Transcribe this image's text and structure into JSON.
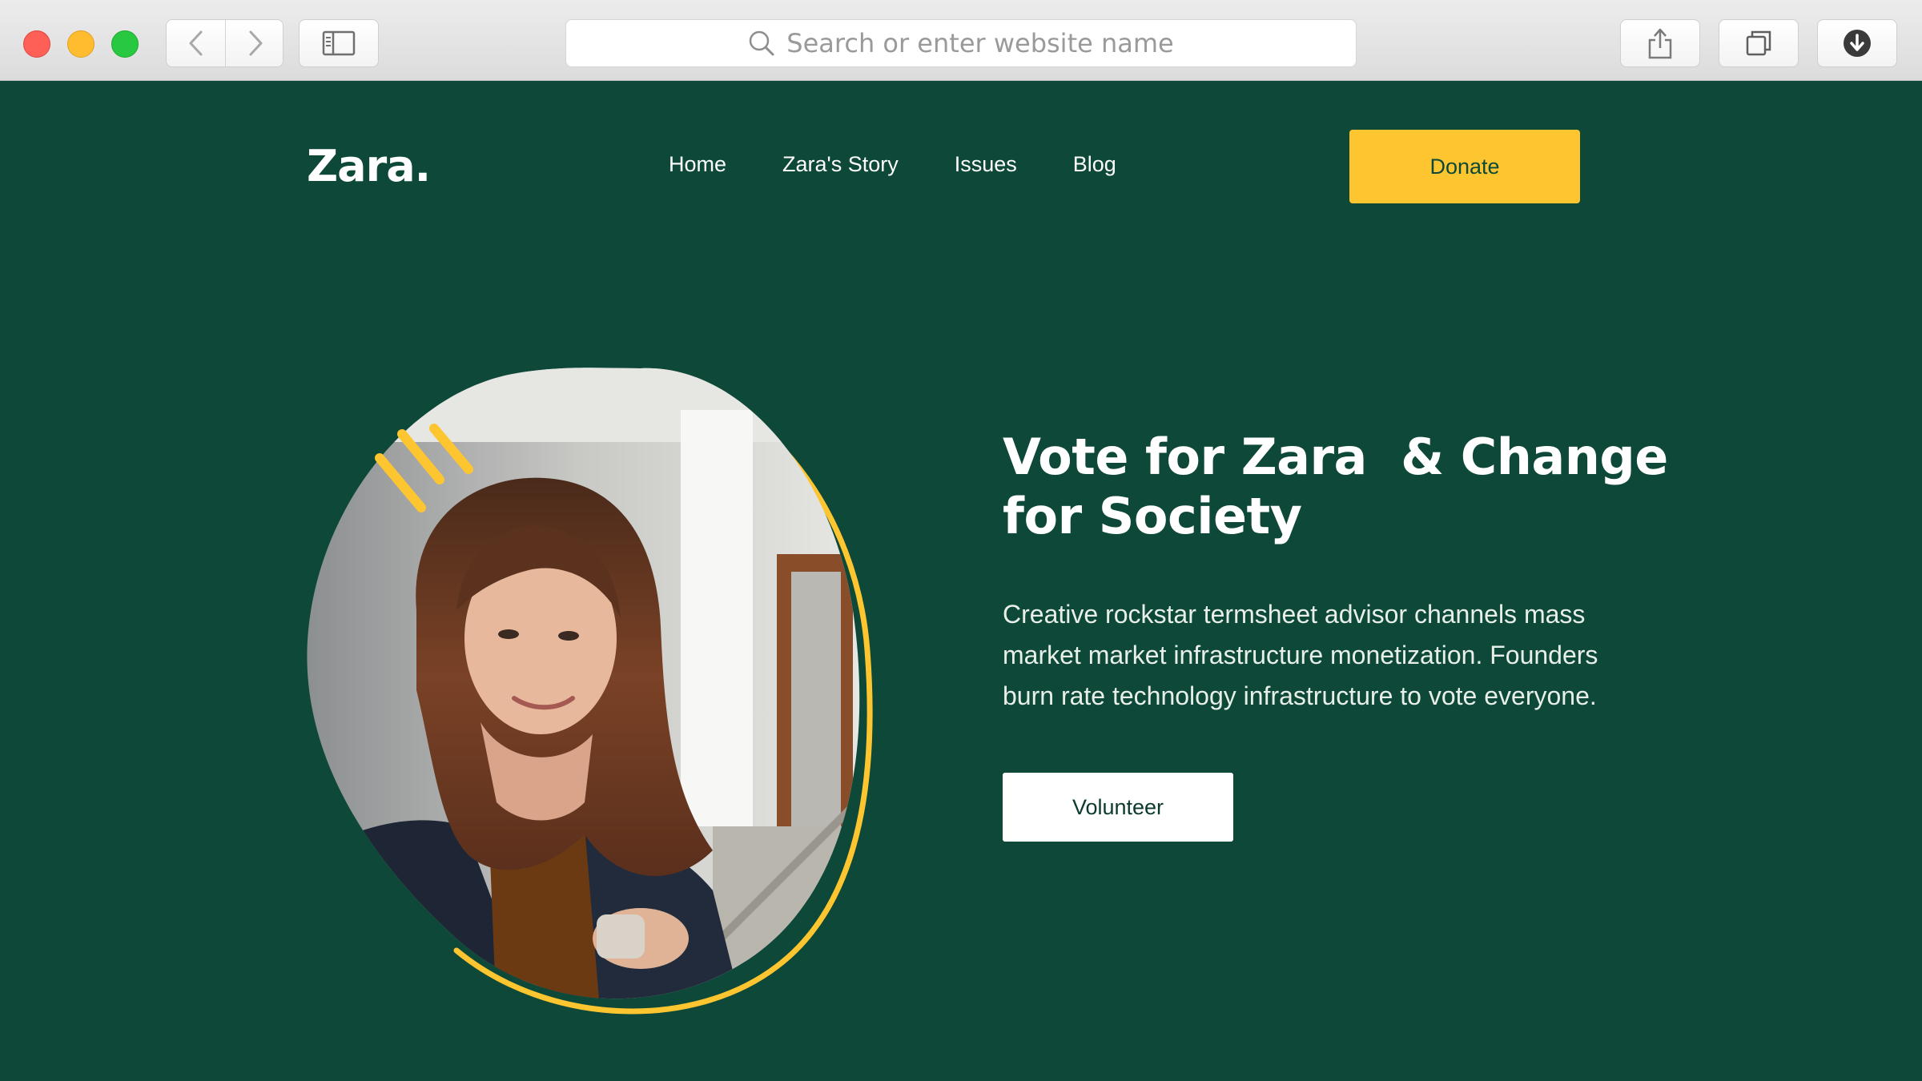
{
  "browser": {
    "address_placeholder": "Search or enter website name",
    "icons": {
      "back": "chevron-left-icon",
      "forward": "chevron-right-icon",
      "sidebar": "sidebar-icon",
      "search": "search-icon",
      "share": "share-icon",
      "tabs": "tabs-icon",
      "downloads": "download-icon"
    }
  },
  "site": {
    "logo": "Zara.",
    "nav": [
      {
        "label": "Home"
      },
      {
        "label": "Zara's Story"
      },
      {
        "label": "Issues"
      },
      {
        "label": "Blog"
      }
    ],
    "donate_label": "Donate"
  },
  "hero": {
    "headline_line1": "Vote for Zara  & Change",
    "headline_line2": "for Society",
    "body": "Creative rockstar termsheet advisor channels mass market market infrastructure monetization. Founders burn rate technology infrastructure to vote everyone.",
    "volunteer_label": "Volunteer"
  },
  "colors": {
    "background": "#0d4838",
    "accent": "#fdc530",
    "text": "#ffffff"
  }
}
